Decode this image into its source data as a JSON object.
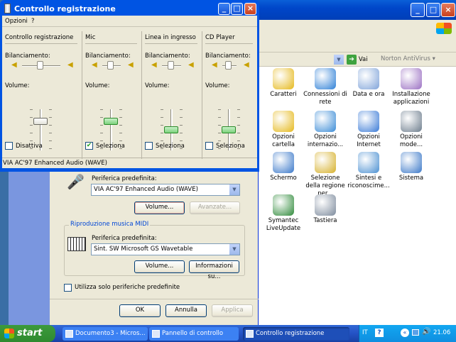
{
  "control_panel": {
    "toolbar": {
      "go_label": "Vai",
      "norton_label": "Norton AntiVirus"
    },
    "items": [
      {
        "label": "Caratteri",
        "icon": "folder-fonts-icon",
        "color": "#e5b81b"
      },
      {
        "label": "Connessioni di rete",
        "icon": "network-globe-icon",
        "color": "#2d7fd6"
      },
      {
        "label": "Data e ora",
        "icon": "clock-icon",
        "color": "#7fa3d9"
      },
      {
        "label": "Installazione applicazioni",
        "icon": "install-cd-icon",
        "color": "#9a6fc2"
      },
      {
        "label": "Opzioni cartella",
        "icon": "folder-options-icon",
        "color": "#e5b81b"
      },
      {
        "label": "Opzioni internazio...",
        "icon": "globe-icon",
        "color": "#3a8bd6"
      },
      {
        "label": "Opzioni Internet",
        "icon": "internet-globe-icon",
        "color": "#3a7ad6"
      },
      {
        "label": "Opzioni mode...",
        "icon": "modem-icon",
        "color": "#6c7c8c"
      },
      {
        "label": "Schermo",
        "icon": "display-icon",
        "color": "#3a78c9"
      },
      {
        "label": "Selezione della regione per...",
        "icon": "phone-icon",
        "color": "#d6b02a"
      },
      {
        "label": "Sintesi e riconoscime...",
        "icon": "speech-icon",
        "color": "#4a8fd1"
      },
      {
        "label": "Sistema",
        "icon": "system-icon",
        "color": "#3b78c8"
      },
      {
        "label": "Symantec LiveUpdate",
        "icon": "liveupdate-icon",
        "color": "#2f8a3a"
      },
      {
        "label": "Tastiera",
        "icon": "keyboard-icon",
        "color": "#7c8a9c"
      }
    ]
  },
  "sound_dialog": {
    "recording_device_label": "Periferica predefinita:",
    "recording_device_value": "VIA AC'97 Enhanced Audio (WAVE)",
    "volume_label": "Volume...",
    "advanced_label": "Avanzate...",
    "midi_group_title": "Riproduzione musica MIDI",
    "midi_device_label": "Periferica predefinita:",
    "midi_device_value": "Sint. SW Microsoft GS Wavetable",
    "midi_volume_label": "Volume...",
    "midi_info_label": "Informazioni su...",
    "only_default_label": "Utilizza solo periferiche predefinite",
    "ok_label": "OK",
    "cancel_label": "Annulla",
    "apply_label": "Applica"
  },
  "mixer": {
    "title": "Controllo registrazione",
    "menu": [
      "Opzioni",
      "?"
    ],
    "balance_label": "Bilanciamento:",
    "volume_label": "Volume:",
    "status": "VIA AC'97 Enhanced Audio (WAVE)",
    "channels": [
      {
        "name": "Controllo registrazione",
        "check_label": "Disattiva",
        "checked": false,
        "volume": 0.75
      },
      {
        "name": "Mic",
        "check_label": "Seleziona",
        "checked": true,
        "volume": 0.75
      },
      {
        "name": "Linea in ingresso",
        "check_label": "Seleziona",
        "checked": false,
        "volume": 0.5
      },
      {
        "name": "CD Player",
        "check_label": "Seleziona",
        "checked": false,
        "volume": 0.5
      }
    ]
  },
  "taskbar": {
    "start_label": "start",
    "tasks": [
      {
        "label": "Documento3 - Micros...",
        "icon": "word-icon"
      },
      {
        "label": "Pannello di controllo",
        "icon": "control-panel-icon"
      },
      {
        "label": "Controllo registrazione",
        "icon": "mixer-icon"
      }
    ],
    "lang": "IT",
    "clock": "21.06"
  }
}
